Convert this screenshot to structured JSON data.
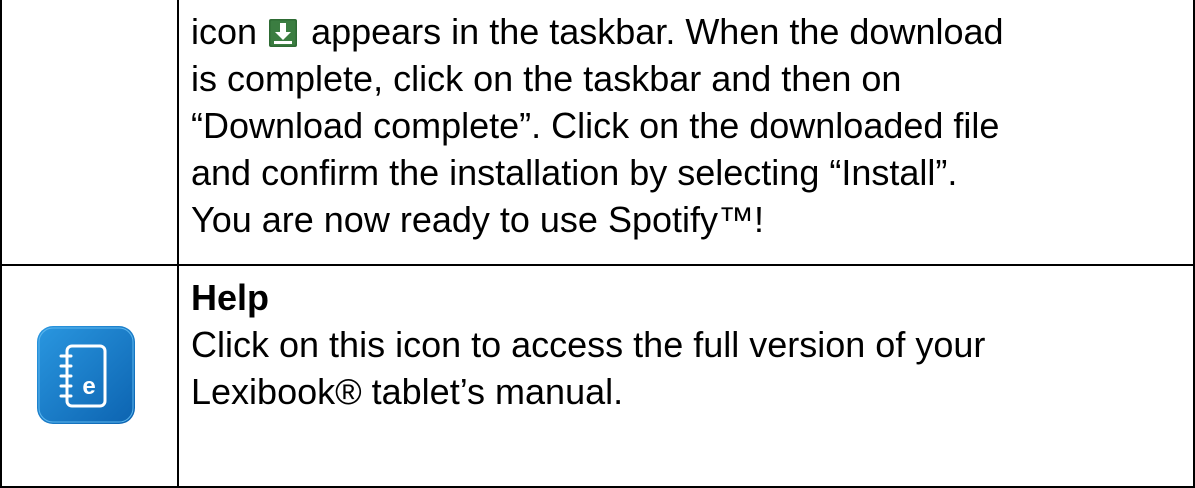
{
  "download_row": {
    "line_1_before_icon": "icon",
    "line_1_after_icon": "appears in the taskbar. When the download",
    "download_icon": "download-arrow-icon",
    "line_2": "is complete, click on the taskbar and then on",
    "line_3": "“Download complete”. Click on the downloaded file",
    "line_4": "and confirm the installation by selecting “Install”.",
    "line_5": "You are now ready to use Spotify™!"
  },
  "help_row": {
    "icon": "help-manual-icon",
    "title": "Help",
    "line_1": "Click on this icon to access the full version of your",
    "line_2": "Lexibook® tablet’s manual."
  },
  "colors": {
    "icon_blue": "#1f86d1",
    "icon_dark_blue": "#0c63b0",
    "download_icon_green": "#2e6b34",
    "border": "#000000"
  }
}
